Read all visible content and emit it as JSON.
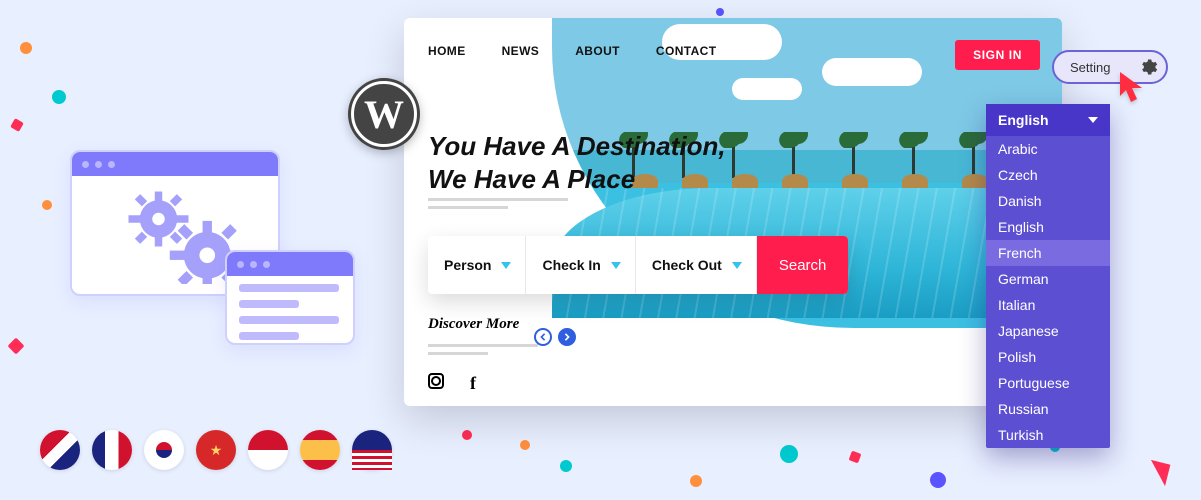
{
  "nav": {
    "home": "HOME",
    "news": "NEWS",
    "about": "ABOUT",
    "contact": "CONTACT"
  },
  "auth": {
    "signin": "SIGN IN"
  },
  "hero": {
    "line1": "You Have A Destination,",
    "line2": "We Have A Place"
  },
  "form": {
    "person": "Person",
    "checkin": "Check In",
    "checkout": "Check Out",
    "search": "Search"
  },
  "discover": {
    "label": "Discover More"
  },
  "setting": {
    "label": "Setting"
  },
  "dropdown": {
    "selected": "English",
    "items": {
      "arabic": "Arabic",
      "czech": "Czech",
      "danish": "Danish",
      "english": "English",
      "french": "French",
      "german": "German",
      "italian": "Italian",
      "japanese": "Japanese",
      "polish": "Polish",
      "portuguese": "Portuguese",
      "russian": "Russian",
      "turkish": "Turkish"
    },
    "highlighted": "French"
  },
  "flags": {
    "uk": "uk",
    "fr": "fr",
    "kr": "kr",
    "cn": "cn",
    "id": "id",
    "es": "es",
    "us": "us"
  }
}
